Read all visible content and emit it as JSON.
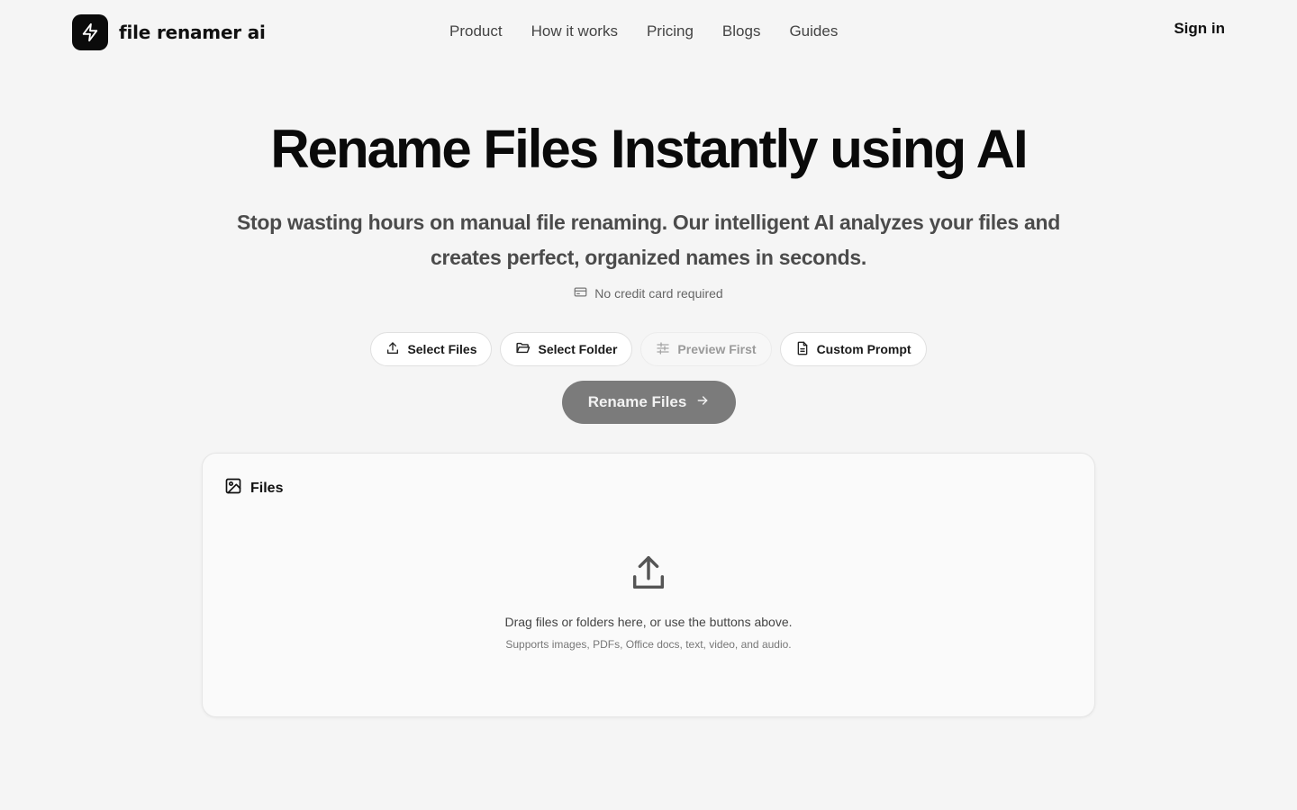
{
  "header": {
    "brand": "file renamer ai",
    "nav": [
      "Product",
      "How it works",
      "Pricing",
      "Blogs",
      "Guides"
    ],
    "signin": "Sign in"
  },
  "hero": {
    "title": "Rename Files Instantly using AI",
    "subtitle": "Stop wasting hours on manual file renaming. Our intelligent AI analyzes your files and creates perfect, organized names in seconds.",
    "note": "No credit card required"
  },
  "options": {
    "select_files": "Select Files",
    "select_folder": "Select Folder",
    "preview_first": "Preview First",
    "custom_prompt": "Custom Prompt"
  },
  "cta": {
    "label": "Rename Files"
  },
  "files": {
    "title": "Files",
    "drop_main": "Drag files or folders here, or use the buttons above.",
    "drop_sub": "Supports images, PDFs, Office docs, text, video, and audio."
  },
  "colors": {
    "background": "#f5f5f5",
    "logo": "#0b0b0b",
    "cta": "#7b7b7b"
  }
}
